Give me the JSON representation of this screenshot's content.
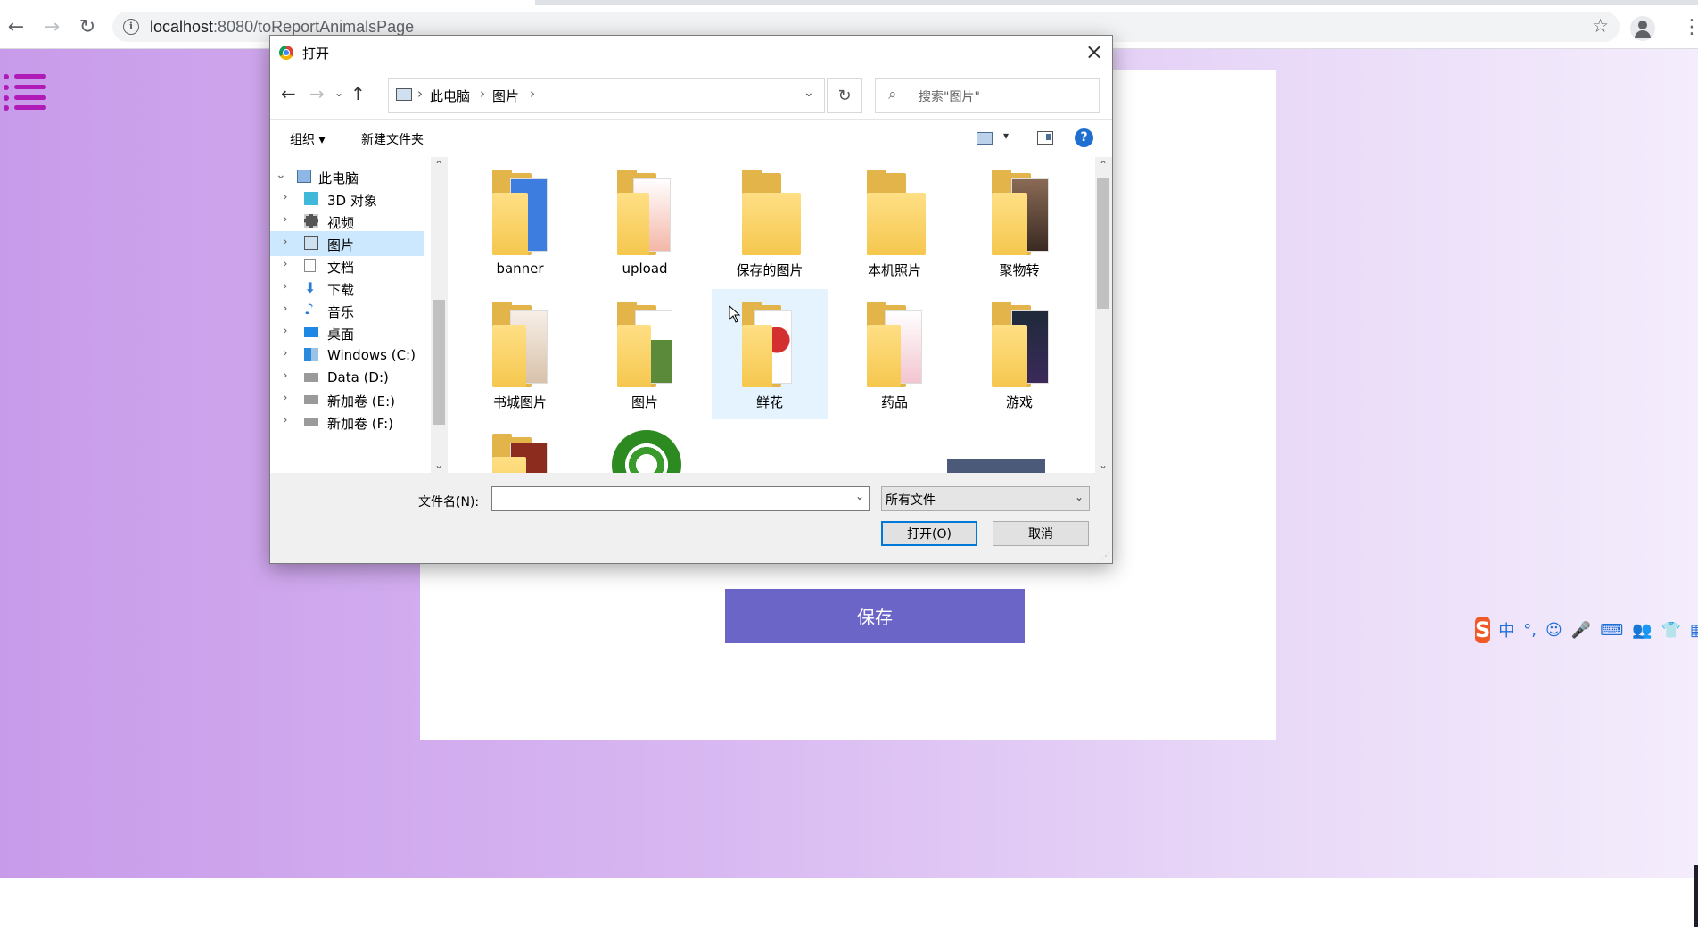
{
  "browser": {
    "url_host": "localhost",
    "url_rest": ":8080/toReportAnimalsPage",
    "nav": {
      "back": "←",
      "forward": "→",
      "reload": "↻"
    },
    "icons": [
      "info-icon",
      "bookmark-star-icon",
      "profile-icon",
      "menu-kebab-icon"
    ]
  },
  "page": {
    "save_label": "保存",
    "accent": "#6b65c8",
    "menu_color": "#b01ab6",
    "ime": {
      "logo": "S",
      "items": [
        "中",
        "°,",
        "☺",
        "🎤",
        "⌨",
        "👥",
        "👕",
        "▦"
      ]
    }
  },
  "dialog": {
    "title": "打开",
    "close": "×",
    "breadcrumbs": [
      "此电脑",
      "图片"
    ],
    "search_placeholder": "搜索\"图片\"",
    "commands": {
      "organize": "组织 ▾",
      "new_folder": "新建文件夹"
    },
    "help": "?",
    "nav_tree": [
      {
        "label": "此电脑",
        "expanded": true,
        "icon": "computer-icon"
      },
      {
        "label": "3D 对象",
        "icon": "3d-objects-icon"
      },
      {
        "label": "视频",
        "icon": "videos-icon"
      },
      {
        "label": "图片",
        "icon": "pictures-icon",
        "selected": true
      },
      {
        "label": "文档",
        "icon": "documents-icon"
      },
      {
        "label": "下载",
        "icon": "downloads-icon"
      },
      {
        "label": "音乐",
        "icon": "music-icon"
      },
      {
        "label": "桌面",
        "icon": "desktop-icon"
      },
      {
        "label": "Windows (C:)",
        "icon": "drive-c-icon"
      },
      {
        "label": "Data (D:)",
        "icon": "drive-d-icon"
      },
      {
        "label": "新加卷 (E:)",
        "icon": "drive-e-icon"
      },
      {
        "label": "新加卷 (F:)",
        "icon": "drive-f-icon"
      }
    ],
    "files": [
      {
        "name": "banner"
      },
      {
        "name": "upload"
      },
      {
        "name": "保存的图片"
      },
      {
        "name": "本机照片"
      },
      {
        "name": "聚物转"
      },
      {
        "name": "书城图片"
      },
      {
        "name": "图片"
      },
      {
        "name": "鲜花",
        "selected": true
      },
      {
        "name": "药品"
      },
      {
        "name": "游戏"
      }
    ],
    "filename_label": "文件名(N):",
    "filename_value": "",
    "filetype": "所有文件",
    "open_label": "打开(O)",
    "cancel_label": "取消"
  }
}
